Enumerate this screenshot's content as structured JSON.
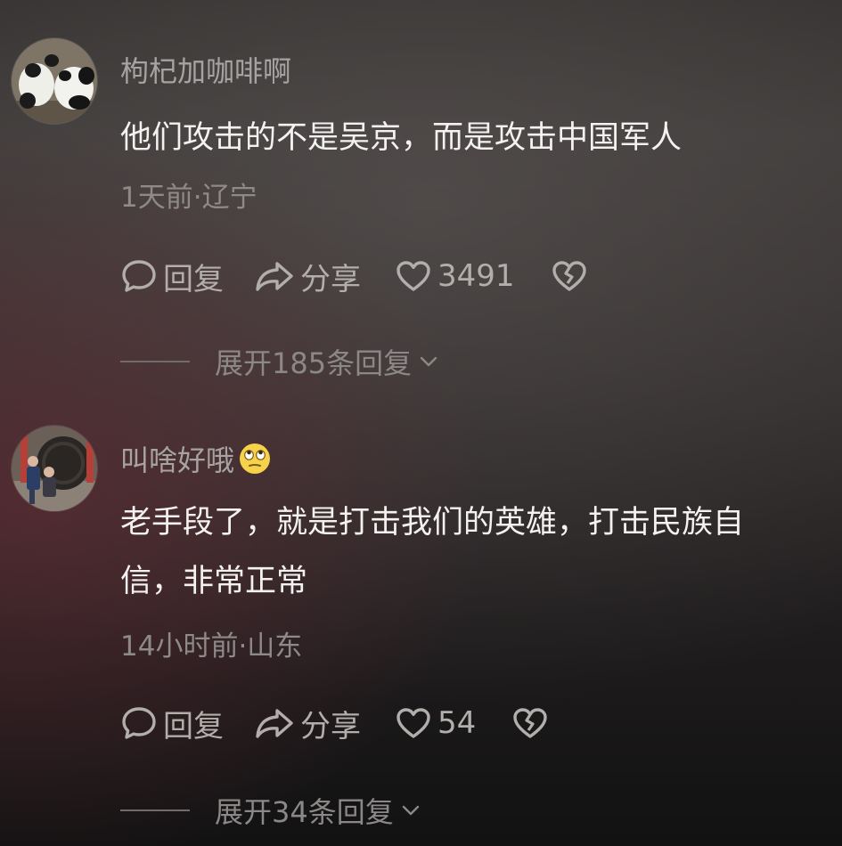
{
  "comments": [
    {
      "username": "枸杞加咖啡啊",
      "avatar_icon": "panda-photo-avatar",
      "text": "他们攻击的不是吴京，而是攻击中国军人",
      "meta": "1天前·辽宁",
      "reply_label": "回复",
      "share_label": "分享",
      "like_count": "3491",
      "expand_label": "展开185条回复"
    },
    {
      "username": "叫啥好哦",
      "username_emoji": "eye-roll-emoji",
      "avatar_icon": "workers-photo-avatar",
      "text": "老手段了，就是打击我们的英雄，打击民族自\n信，非常正常",
      "meta": "14小时前·山东",
      "reply_label": "回复",
      "share_label": "分享",
      "like_count": "54",
      "expand_label": "展开34条回复"
    }
  ],
  "colors": {
    "text_primary": "#f3f2f1",
    "text_secondary": "#a6a3a2",
    "icon_gray": "#b1aeac"
  }
}
